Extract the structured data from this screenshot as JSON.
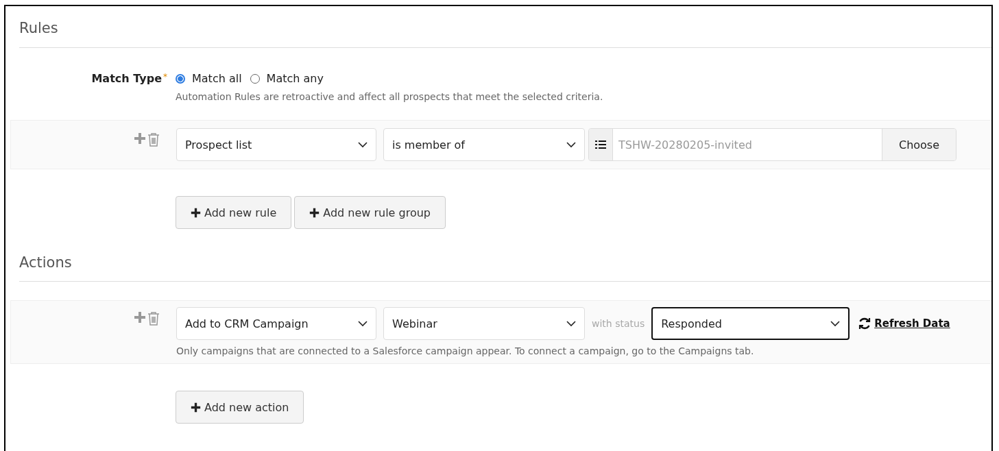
{
  "rules": {
    "heading": "Rules",
    "match_type": {
      "label": "Match Type",
      "required_mark": "*",
      "options": [
        {
          "label": "Match all",
          "selected": true
        },
        {
          "label": "Match any",
          "selected": false
        }
      ],
      "help": "Automation Rules are retroactive and affect all prospects that meet the selected criteria."
    },
    "rows": [
      {
        "field": "Prospect list",
        "operator": "is member of",
        "list_placeholder": "TSHW-20280205-invited",
        "choose_button": "Choose"
      }
    ],
    "buttons": [
      {
        "label": "Add new rule"
      },
      {
        "label": "Add new rule group"
      }
    ]
  },
  "actions": {
    "heading": "Actions",
    "rows": [
      {
        "action": "Add to CRM Campaign",
        "campaign": "Webinar",
        "status_label": "with status",
        "status": "Responded",
        "status_focused": true,
        "refresh_link": "Refresh Data",
        "help": "Only campaigns that are connected to a Salesforce campaign appear. To connect a campaign, go to the Campaigns tab."
      }
    ],
    "buttons": [
      {
        "label": "Add new action"
      }
    ]
  }
}
